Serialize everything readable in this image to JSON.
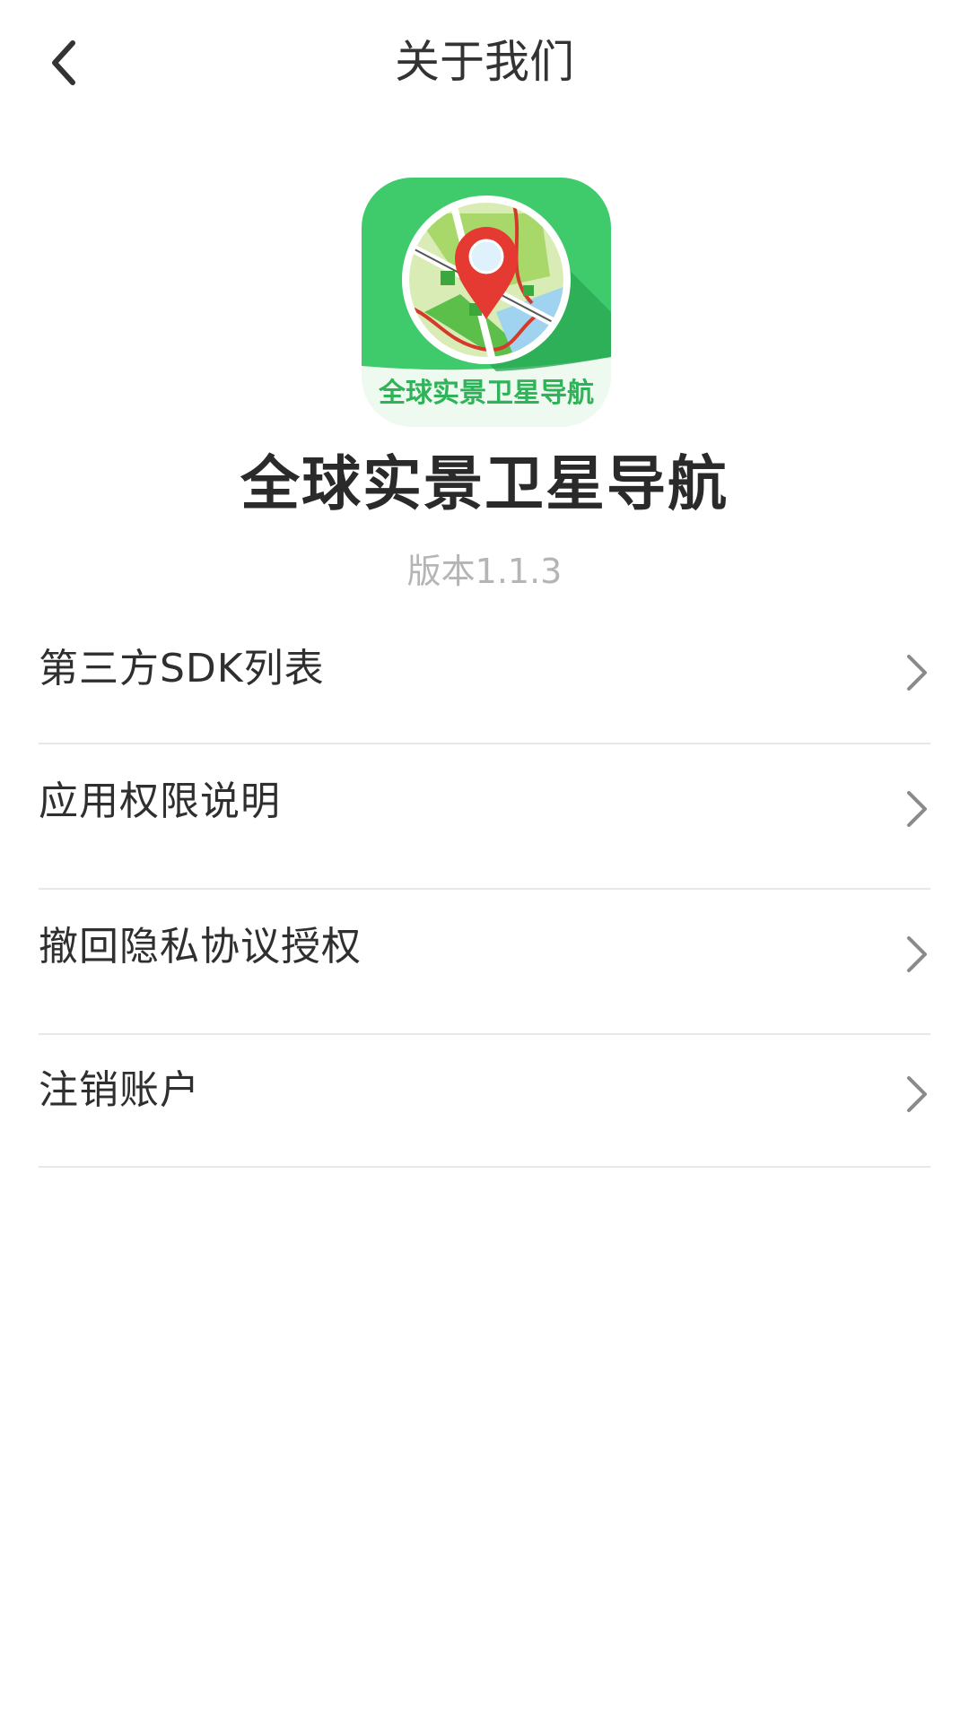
{
  "header": {
    "title": "关于我们",
    "back_icon": "chevron-left-icon"
  },
  "app": {
    "name": "全球实景卫星导航",
    "version": "版本1.1.3",
    "logo_caption": "全球实景卫星导航",
    "logo_icon": "map-pin-logo-icon"
  },
  "menu": {
    "items": [
      {
        "label": "第三方SDK列表",
        "icon": "chevron-right-icon"
      },
      {
        "label": "应用权限说明",
        "icon": "chevron-right-icon"
      },
      {
        "label": "撤回隐私协议授权",
        "icon": "chevron-right-icon"
      },
      {
        "label": "注销账户",
        "icon": "chevron-right-icon"
      }
    ]
  },
  "colors": {
    "logo_green": "#37c466",
    "pin_red": "#e43a32",
    "caption_green": "#2fb358",
    "divider": "#e8e8e8",
    "text": "#333333",
    "version": "#b5b5b5"
  }
}
